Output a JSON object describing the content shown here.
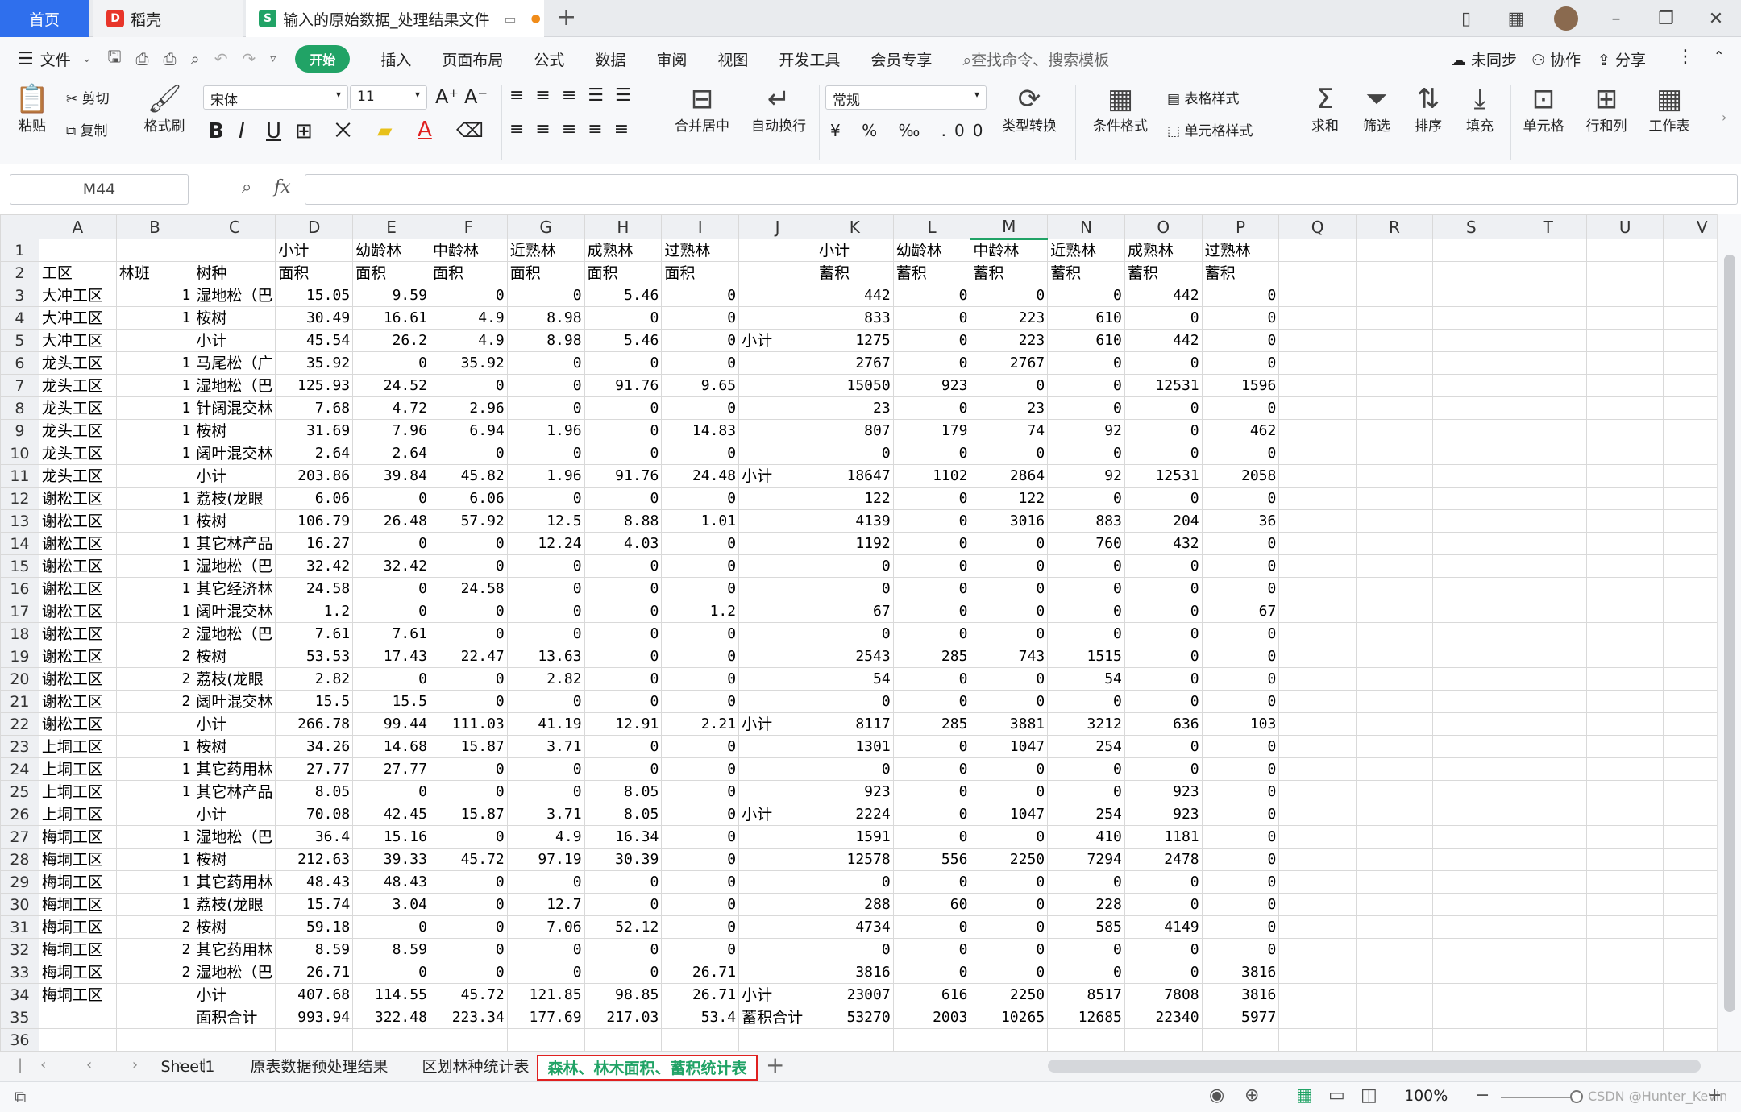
{
  "window_tabs": [
    {
      "label": "首页"
    },
    {
      "label": "稻壳"
    },
    {
      "label": "输入的原始数据_处理结果文件"
    }
  ],
  "menu": {
    "file": "文件",
    "items": [
      "开始",
      "插入",
      "页面布局",
      "公式",
      "数据",
      "审阅",
      "视图",
      "开发工具",
      "会员专享"
    ],
    "search_placeholder": "查找命令、搜索模板",
    "sync": "未同步",
    "collab": "协作",
    "share": "分享"
  },
  "ribbon": {
    "paste": "粘贴",
    "cut": "剪切",
    "copy": "复制",
    "format_painter": "格式刷",
    "font_name": "宋体",
    "font_size": "11",
    "merge_center": "合并居中",
    "wrap": "自动换行",
    "number_format": "常规",
    "type_convert": "类型转换",
    "cond_format": "条件格式",
    "table_style": "表格样式",
    "cell_style": "单元格样式",
    "sum": "求和",
    "filter": "筛选",
    "sort": "排序",
    "fill": "填充",
    "cell": "单元格",
    "rowcol": "行和列",
    "sheet": "工作表"
  },
  "formula_bar": {
    "name_box": "M44",
    "fx": "fx"
  },
  "grid": {
    "columns": [
      "A",
      "B",
      "C",
      "D",
      "E",
      "F",
      "G",
      "H",
      "I",
      "J",
      "K",
      "L",
      "M",
      "N",
      "O",
      "P",
      "Q",
      "R",
      "S",
      "T",
      "U",
      "V"
    ],
    "selected_column": "M",
    "rows": [
      [
        "",
        "",
        "",
        "小计",
        "幼龄林",
        "中龄林",
        "近熟林",
        "成熟林",
        "过熟林",
        "",
        "小计",
        "幼龄林",
        "中龄林",
        "近熟林",
        "成熟林",
        "过熟林"
      ],
      [
        "工区",
        "林班",
        "树种",
        "面积",
        "面积",
        "面积",
        "面积",
        "面积",
        "面积",
        "",
        "蓄积",
        "蓄积",
        "蓄积",
        "蓄积",
        "蓄积",
        "蓄积"
      ],
      [
        "大冲工区",
        "1",
        "湿地松（巴",
        "15.05",
        "9.59",
        "0",
        "0",
        "5.46",
        "0",
        "",
        "442",
        "0",
        "0",
        "0",
        "442",
        "0"
      ],
      [
        "大冲工区",
        "1",
        "桉树",
        "30.49",
        "16.61",
        "4.9",
        "8.98",
        "0",
        "0",
        "",
        "833",
        "0",
        "223",
        "610",
        "0",
        "0"
      ],
      [
        "大冲工区",
        "",
        "小计",
        "45.54",
        "26.2",
        "4.9",
        "8.98",
        "5.46",
        "0",
        "小计",
        "1275",
        "0",
        "223",
        "610",
        "442",
        "0"
      ],
      [
        "龙头工区",
        "1",
        "马尾松（广",
        "35.92",
        "0",
        "35.92",
        "0",
        "0",
        "0",
        "",
        "2767",
        "0",
        "2767",
        "0",
        "0",
        "0"
      ],
      [
        "龙头工区",
        "1",
        "湿地松（巴",
        "125.93",
        "24.52",
        "0",
        "0",
        "91.76",
        "9.65",
        "",
        "15050",
        "923",
        "0",
        "0",
        "12531",
        "1596"
      ],
      [
        "龙头工区",
        "1",
        "针阔混交林",
        "7.68",
        "4.72",
        "2.96",
        "0",
        "0",
        "0",
        "",
        "23",
        "0",
        "23",
        "0",
        "0",
        "0"
      ],
      [
        "龙头工区",
        "1",
        "桉树",
        "31.69",
        "7.96",
        "6.94",
        "1.96",
        "0",
        "14.83",
        "",
        "807",
        "179",
        "74",
        "92",
        "0",
        "462"
      ],
      [
        "龙头工区",
        "1",
        "阔叶混交林",
        "2.64",
        "2.64",
        "0",
        "0",
        "0",
        "0",
        "",
        "0",
        "0",
        "0",
        "0",
        "0",
        "0"
      ],
      [
        "龙头工区",
        "",
        "小计",
        "203.86",
        "39.84",
        "45.82",
        "1.96",
        "91.76",
        "24.48",
        "小计",
        "18647",
        "1102",
        "2864",
        "92",
        "12531",
        "2058"
      ],
      [
        "谢松工区",
        "1",
        "荔枝(龙眼",
        "6.06",
        "0",
        "6.06",
        "0",
        "0",
        "0",
        "",
        "122",
        "0",
        "122",
        "0",
        "0",
        "0"
      ],
      [
        "谢松工区",
        "1",
        "桉树",
        "106.79",
        "26.48",
        "57.92",
        "12.5",
        "8.88",
        "1.01",
        "",
        "4139",
        "0",
        "3016",
        "883",
        "204",
        "36"
      ],
      [
        "谢松工区",
        "1",
        "其它林产品",
        "16.27",
        "0",
        "0",
        "12.24",
        "4.03",
        "0",
        "",
        "1192",
        "0",
        "0",
        "760",
        "432",
        "0"
      ],
      [
        "谢松工区",
        "1",
        "湿地松（巴",
        "32.42",
        "32.42",
        "0",
        "0",
        "0",
        "0",
        "",
        "0",
        "0",
        "0",
        "0",
        "0",
        "0"
      ],
      [
        "谢松工区",
        "1",
        "其它经济林",
        "24.58",
        "0",
        "24.58",
        "0",
        "0",
        "0",
        "",
        "0",
        "0",
        "0",
        "0",
        "0",
        "0"
      ],
      [
        "谢松工区",
        "1",
        "阔叶混交林",
        "1.2",
        "0",
        "0",
        "0",
        "0",
        "1.2",
        "",
        "67",
        "0",
        "0",
        "0",
        "0",
        "67"
      ],
      [
        "谢松工区",
        "2",
        "湿地松（巴",
        "7.61",
        "7.61",
        "0",
        "0",
        "0",
        "0",
        "",
        "0",
        "0",
        "0",
        "0",
        "0",
        "0"
      ],
      [
        "谢松工区",
        "2",
        "桉树",
        "53.53",
        "17.43",
        "22.47",
        "13.63",
        "0",
        "0",
        "",
        "2543",
        "285",
        "743",
        "1515",
        "0",
        "0"
      ],
      [
        "谢松工区",
        "2",
        "荔枝(龙眼",
        "2.82",
        "0",
        "0",
        "2.82",
        "0",
        "0",
        "",
        "54",
        "0",
        "0",
        "54",
        "0",
        "0"
      ],
      [
        "谢松工区",
        "2",
        "阔叶混交林",
        "15.5",
        "15.5",
        "0",
        "0",
        "0",
        "0",
        "",
        "0",
        "0",
        "0",
        "0",
        "0",
        "0"
      ],
      [
        "谢松工区",
        "",
        "小计",
        "266.78",
        "99.44",
        "111.03",
        "41.19",
        "12.91",
        "2.21",
        "小计",
        "8117",
        "285",
        "3881",
        "3212",
        "636",
        "103"
      ],
      [
        "上垌工区",
        "1",
        "桉树",
        "34.26",
        "14.68",
        "15.87",
        "3.71",
        "0",
        "0",
        "",
        "1301",
        "0",
        "1047",
        "254",
        "0",
        "0"
      ],
      [
        "上垌工区",
        "1",
        "其它药用林",
        "27.77",
        "27.77",
        "0",
        "0",
        "0",
        "0",
        "",
        "0",
        "0",
        "0",
        "0",
        "0",
        "0"
      ],
      [
        "上垌工区",
        "1",
        "其它林产品",
        "8.05",
        "0",
        "0",
        "0",
        "8.05",
        "0",
        "",
        "923",
        "0",
        "0",
        "0",
        "923",
        "0"
      ],
      [
        "上垌工区",
        "",
        "小计",
        "70.08",
        "42.45",
        "15.87",
        "3.71",
        "8.05",
        "0",
        "小计",
        "2224",
        "0",
        "1047",
        "254",
        "923",
        "0"
      ],
      [
        "梅垌工区",
        "1",
        "湿地松（巴",
        "36.4",
        "15.16",
        "0",
        "4.9",
        "16.34",
        "0",
        "",
        "1591",
        "0",
        "0",
        "410",
        "1181",
        "0"
      ],
      [
        "梅垌工区",
        "1",
        "桉树",
        "212.63",
        "39.33",
        "45.72",
        "97.19",
        "30.39",
        "0",
        "",
        "12578",
        "556",
        "2250",
        "7294",
        "2478",
        "0"
      ],
      [
        "梅垌工区",
        "1",
        "其它药用林",
        "48.43",
        "48.43",
        "0",
        "0",
        "0",
        "0",
        "",
        "0",
        "0",
        "0",
        "0",
        "0",
        "0"
      ],
      [
        "梅垌工区",
        "1",
        "荔枝(龙眼",
        "15.74",
        "3.04",
        "0",
        "12.7",
        "0",
        "0",
        "",
        "288",
        "60",
        "0",
        "228",
        "0",
        "0"
      ],
      [
        "梅垌工区",
        "2",
        "桉树",
        "59.18",
        "0",
        "0",
        "7.06",
        "52.12",
        "0",
        "",
        "4734",
        "0",
        "0",
        "585",
        "4149",
        "0"
      ],
      [
        "梅垌工区",
        "2",
        "其它药用林",
        "8.59",
        "8.59",
        "0",
        "0",
        "0",
        "0",
        "",
        "0",
        "0",
        "0",
        "0",
        "0",
        "0"
      ],
      [
        "梅垌工区",
        "2",
        "湿地松（巴",
        "26.71",
        "0",
        "0",
        "0",
        "0",
        "26.71",
        "",
        "3816",
        "0",
        "0",
        "0",
        "0",
        "3816"
      ],
      [
        "梅垌工区",
        "",
        "小计",
        "407.68",
        "114.55",
        "45.72",
        "121.85",
        "98.85",
        "26.71",
        "小计",
        "23007",
        "616",
        "2250",
        "8517",
        "7808",
        "3816"
      ],
      [
        "",
        "",
        "面积合计",
        "993.94",
        "322.48",
        "223.34",
        "177.69",
        "217.03",
        "53.4",
        "蓄积合计",
        "53270",
        "2003",
        "10265",
        "12685",
        "22340",
        "5977"
      ],
      [
        "",
        "",
        "",
        "",
        "",
        "",
        "",
        "",
        "",
        "",
        "",
        "",
        "",
        "",
        "",
        ""
      ]
    ]
  },
  "sheet_tabs": [
    "Sheet1",
    "原表数据预处理结果",
    "区划林种统计表",
    "森林、林木面积、蓄积统计表"
  ],
  "active_sheet": 3,
  "status": {
    "zoom": "100%",
    "watermark": "CSDN @Hunter_Kevin"
  },
  "colors": {
    "accent": "#21a366",
    "active_tab_border": "#e02020",
    "home_tab": "#2f6fed"
  }
}
